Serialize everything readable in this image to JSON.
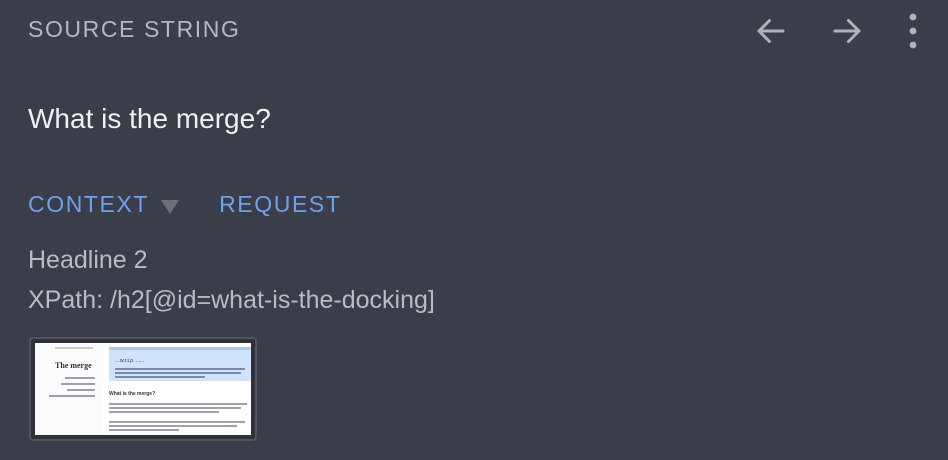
{
  "header": {
    "section_label": "SOURCE STRING",
    "icons": [
      "arrow-left-icon",
      "arrow-right-icon",
      "more-vertical-icon"
    ]
  },
  "source": {
    "text": "What is the merge?"
  },
  "tabs": [
    {
      "label": "CONTEXT",
      "selected": true
    },
    {
      "label": "REQUEST",
      "selected": false
    }
  ],
  "context": {
    "headline": "Headline 2",
    "xpath": "XPath: /h2[@id=what-is-the-docking]"
  },
  "thumbnail": {
    "sidebar_title": "The merge",
    "highlight_title": "…w.r.t.p. ......",
    "section_heading": "What is the merge?"
  },
  "colors": {
    "background": "#3a3e48",
    "accent": "#6ea0f0",
    "text_primary": "#eef0f3",
    "text_secondary": "#b9bcc2"
  }
}
